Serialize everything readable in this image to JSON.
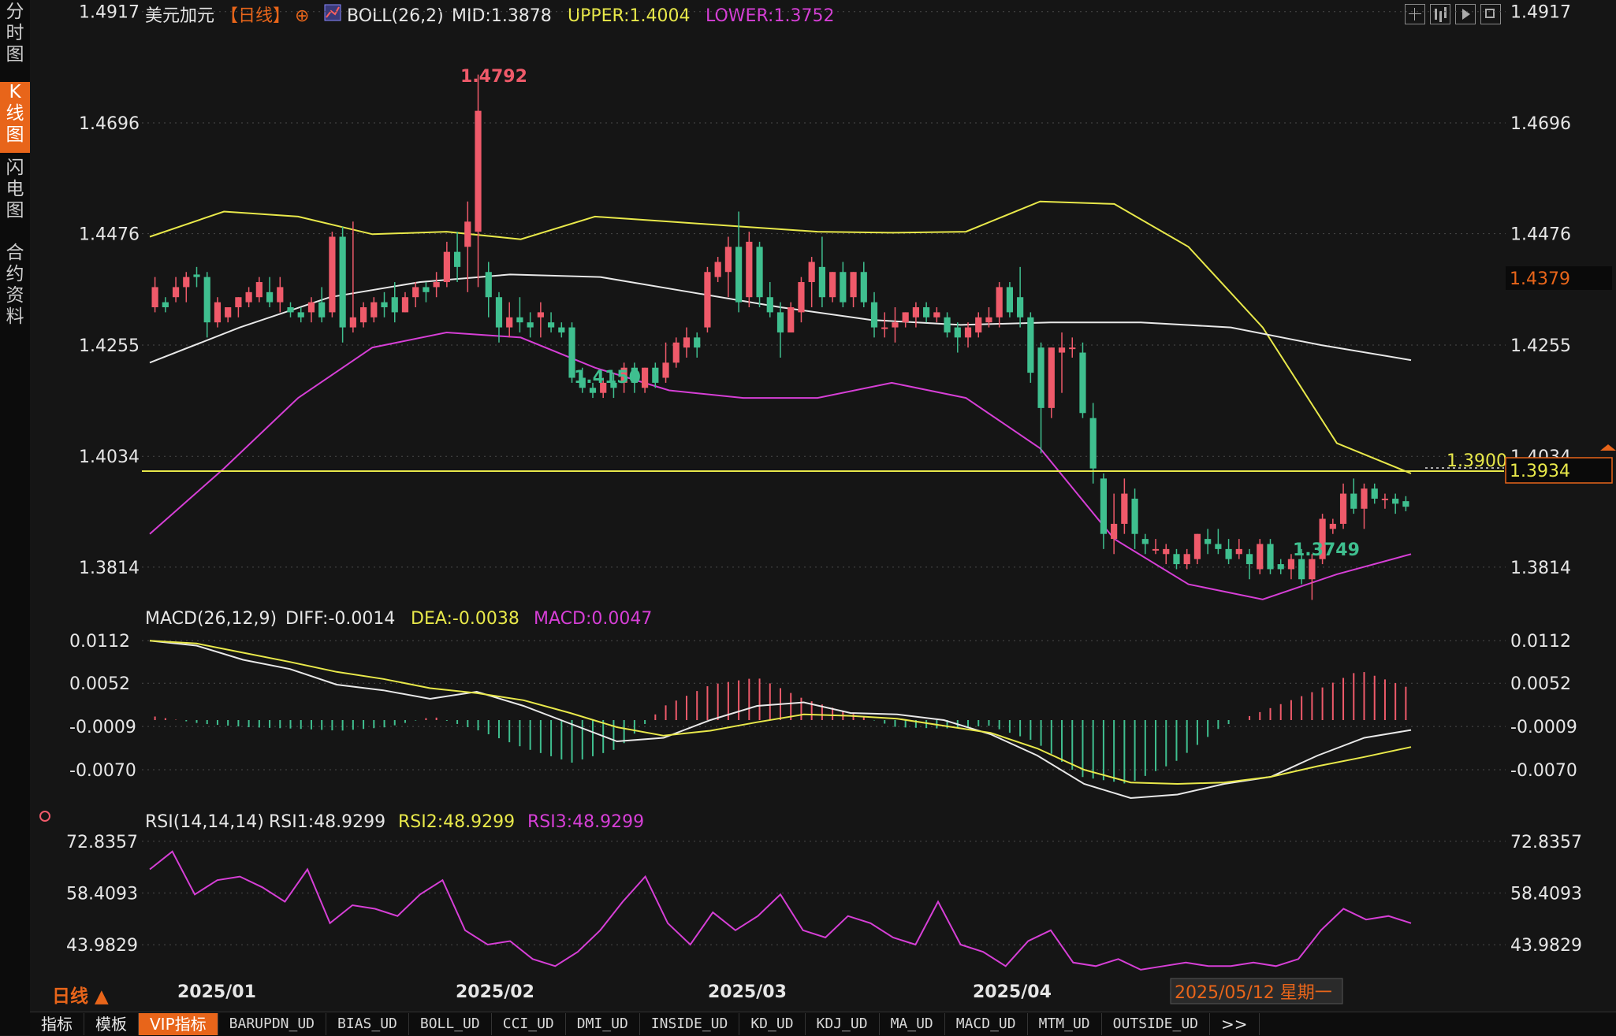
{
  "sidebar": {
    "items": [
      "分时图",
      "K线图",
      "闪电图",
      "合约资料"
    ],
    "active": 1
  },
  "header": {
    "instrument": "美元加元",
    "period": "【日线】",
    "add_symbol": "⊕",
    "boll": {
      "label": "BOLL(26,2)",
      "mid": "MID:1.3878",
      "upper": "UPPER:1.4004",
      "lower": "LOWER:1.3752"
    }
  },
  "price_axis": {
    "ticks": [
      "1.4917",
      "1.4696",
      "1.4476",
      "1.4255",
      "1.4034",
      "1.3814"
    ]
  },
  "annotations": {
    "high": "1.4792",
    "low1": "1.4150",
    "low2": "1.3749",
    "hline": "1.3900",
    "right_tag_1": "1.4379",
    "right_tag_2": "1.3934"
  },
  "macd": {
    "label": "MACD(26,12,9)",
    "diff": "DIFF:-0.0014",
    "dea": "DEA:-0.0038",
    "macd": "MACD:0.0047",
    "ticks": [
      "0.0112",
      "0.0052",
      "-0.0009",
      "-0.0070"
    ]
  },
  "rsi": {
    "label": "RSI(14,14,14)",
    "rsi1": "RSI1:48.9299",
    "rsi2": "RSI2:48.9299",
    "rsi3": "RSI3:48.9299",
    "ticks": [
      "72.8357",
      "58.4093",
      "43.9829"
    ]
  },
  "time_axis": {
    "labels": [
      "2025/01",
      "2025/02",
      "2025/03",
      "2025/04"
    ],
    "cursor_date": "2025/05/12 星期一"
  },
  "period_selector": "日线 ▲",
  "bottom_bar": [
    "指标",
    "模板",
    "VIP指标",
    "BARUPDN_UD",
    "BIAS_UD",
    "BOLL_UD",
    "CCI_UD",
    "DMI_UD",
    "INSIDE_UD",
    "KD_UD",
    "KDJ_UD",
    "MA_UD",
    "MACD_UD",
    "MTM_UD",
    "OUTSIDE_UD",
    ">>"
  ],
  "colors": {
    "up": "#ef5a6a",
    "down": "#3fbf8f",
    "boll_mid": "#e8e8e8",
    "boll_upper": "#e8e84a",
    "boll_lower": "#d63fd6",
    "accent": "#e8651a"
  },
  "chart_data": {
    "type": "candlestick",
    "price_axis_range": [
      1.372,
      1.494
    ],
    "candles": [
      {
        "o": 1.433,
        "h": 1.439,
        "l": 1.432,
        "c": 1.437
      },
      {
        "o": 1.434,
        "h": 1.435,
        "l": 1.432,
        "c": 1.433
      },
      {
        "o": 1.435,
        "h": 1.439,
        "l": 1.434,
        "c": 1.437
      },
      {
        "o": 1.437,
        "h": 1.44,
        "l": 1.434,
        "c": 1.439
      },
      {
        "o": 1.4395,
        "h": 1.441,
        "l": 1.437,
        "c": 1.439
      },
      {
        "o": 1.439,
        "h": 1.44,
        "l": 1.427,
        "c": 1.43
      },
      {
        "o": 1.43,
        "h": 1.435,
        "l": 1.429,
        "c": 1.434
      },
      {
        "o": 1.431,
        "h": 1.433,
        "l": 1.43,
        "c": 1.433
      },
      {
        "o": 1.433,
        "h": 1.435,
        "l": 1.431,
        "c": 1.435
      },
      {
        "o": 1.434,
        "h": 1.437,
        "l": 1.433,
        "c": 1.436
      },
      {
        "o": 1.435,
        "h": 1.439,
        "l": 1.434,
        "c": 1.438
      },
      {
        "o": 1.436,
        "h": 1.439,
        "l": 1.433,
        "c": 1.434
      },
      {
        "o": 1.434,
        "h": 1.439,
        "l": 1.432,
        "c": 1.437
      },
      {
        "o": 1.433,
        "h": 1.434,
        "l": 1.431,
        "c": 1.432
      },
      {
        "o": 1.432,
        "h": 1.433,
        "l": 1.43,
        "c": 1.431
      },
      {
        "o": 1.432,
        "h": 1.435,
        "l": 1.43,
        "c": 1.434
      },
      {
        "o": 1.434,
        "h": 1.437,
        "l": 1.43,
        "c": 1.431
      },
      {
        "o": 1.432,
        "h": 1.448,
        "l": 1.431,
        "c": 1.447
      },
      {
        "o": 1.447,
        "h": 1.449,
        "l": 1.426,
        "c": 1.429
      },
      {
        "o": 1.429,
        "h": 1.45,
        "l": 1.428,
        "c": 1.431
      },
      {
        "o": 1.43,
        "h": 1.434,
        "l": 1.429,
        "c": 1.433
      },
      {
        "o": 1.431,
        "h": 1.435,
        "l": 1.43,
        "c": 1.434
      },
      {
        "o": 1.434,
        "h": 1.436,
        "l": 1.431,
        "c": 1.433
      },
      {
        "o": 1.435,
        "h": 1.438,
        "l": 1.43,
        "c": 1.432
      },
      {
        "o": 1.432,
        "h": 1.436,
        "l": 1.432,
        "c": 1.435
      },
      {
        "o": 1.435,
        "h": 1.438,
        "l": 1.433,
        "c": 1.437
      },
      {
        "o": 1.437,
        "h": 1.438,
        "l": 1.434,
        "c": 1.436
      },
      {
        "o": 1.437,
        "h": 1.44,
        "l": 1.435,
        "c": 1.438
      },
      {
        "o": 1.438,
        "h": 1.446,
        "l": 1.437,
        "c": 1.444
      },
      {
        "o": 1.444,
        "h": 1.448,
        "l": 1.438,
        "c": 1.441
      },
      {
        "o": 1.445,
        "h": 1.454,
        "l": 1.436,
        "c": 1.45
      },
      {
        "o": 1.448,
        "h": 1.4792,
        "l": 1.437,
        "c": 1.472
      },
      {
        "o": 1.44,
        "h": 1.442,
        "l": 1.431,
        "c": 1.435
      },
      {
        "o": 1.435,
        "h": 1.436,
        "l": 1.426,
        "c": 1.429
      },
      {
        "o": 1.429,
        "h": 1.434,
        "l": 1.427,
        "c": 1.431
      },
      {
        "o": 1.431,
        "h": 1.435,
        "l": 1.428,
        "c": 1.43
      },
      {
        "o": 1.43,
        "h": 1.432,
        "l": 1.427,
        "c": 1.429
      },
      {
        "o": 1.431,
        "h": 1.434,
        "l": 1.427,
        "c": 1.432
      },
      {
        "o": 1.43,
        "h": 1.432,
        "l": 1.428,
        "c": 1.429
      },
      {
        "o": 1.429,
        "h": 1.43,
        "l": 1.427,
        "c": 1.428
      },
      {
        "o": 1.429,
        "h": 1.43,
        "l": 1.418,
        "c": 1.419
      },
      {
        "o": 1.419,
        "h": 1.421,
        "l": 1.416,
        "c": 1.417
      },
      {
        "o": 1.417,
        "h": 1.418,
        "l": 1.415,
        "c": 1.416
      },
      {
        "o": 1.416,
        "h": 1.419,
        "l": 1.415,
        "c": 1.418
      },
      {
        "o": 1.418,
        "h": 1.42,
        "l": 1.415,
        "c": 1.417
      },
      {
        "o": 1.418,
        "h": 1.422,
        "l": 1.416,
        "c": 1.421
      },
      {
        "o": 1.421,
        "h": 1.422,
        "l": 1.416,
        "c": 1.418
      },
      {
        "o": 1.417,
        "h": 1.421,
        "l": 1.416,
        "c": 1.421
      },
      {
        "o": 1.421,
        "h": 1.422,
        "l": 1.417,
        "c": 1.418
      },
      {
        "o": 1.419,
        "h": 1.426,
        "l": 1.418,
        "c": 1.422
      },
      {
        "o": 1.422,
        "h": 1.427,
        "l": 1.421,
        "c": 1.426
      },
      {
        "o": 1.425,
        "h": 1.429,
        "l": 1.423,
        "c": 1.427
      },
      {
        "o": 1.427,
        "h": 1.428,
        "l": 1.423,
        "c": 1.425
      },
      {
        "o": 1.429,
        "h": 1.441,
        "l": 1.428,
        "c": 1.44
      },
      {
        "o": 1.439,
        "h": 1.443,
        "l": 1.438,
        "c": 1.442
      },
      {
        "o": 1.44,
        "h": 1.447,
        "l": 1.435,
        "c": 1.445
      },
      {
        "o": 1.445,
        "h": 1.452,
        "l": 1.432,
        "c": 1.434
      },
      {
        "o": 1.435,
        "h": 1.448,
        "l": 1.433,
        "c": 1.446
      },
      {
        "o": 1.445,
        "h": 1.446,
        "l": 1.433,
        "c": 1.435
      },
      {
        "o": 1.435,
        "h": 1.438,
        "l": 1.431,
        "c": 1.432
      },
      {
        "o": 1.432,
        "h": 1.434,
        "l": 1.423,
        "c": 1.428
      },
      {
        "o": 1.428,
        "h": 1.434,
        "l": 1.428,
        "c": 1.433
      },
      {
        "o": 1.432,
        "h": 1.439,
        "l": 1.43,
        "c": 1.438
      },
      {
        "o": 1.438,
        "h": 1.443,
        "l": 1.433,
        "c": 1.442
      },
      {
        "o": 1.441,
        "h": 1.447,
        "l": 1.433,
        "c": 1.435
      },
      {
        "o": 1.435,
        "h": 1.44,
        "l": 1.434,
        "c": 1.44
      },
      {
        "o": 1.44,
        "h": 1.442,
        "l": 1.433,
        "c": 1.434
      },
      {
        "o": 1.435,
        "h": 1.44,
        "l": 1.433,
        "c": 1.44
      },
      {
        "o": 1.44,
        "h": 1.442,
        "l": 1.433,
        "c": 1.434
      },
      {
        "o": 1.434,
        "h": 1.436,
        "l": 1.427,
        "c": 1.429
      },
      {
        "o": 1.429,
        "h": 1.432,
        "l": 1.427,
        "c": 1.429
      },
      {
        "o": 1.429,
        "h": 1.433,
        "l": 1.426,
        "c": 1.43
      },
      {
        "o": 1.43,
        "h": 1.432,
        "l": 1.429,
        "c": 1.432
      },
      {
        "o": 1.431,
        "h": 1.434,
        "l": 1.429,
        "c": 1.433
      },
      {
        "o": 1.433,
        "h": 1.434,
        "l": 1.43,
        "c": 1.431
      },
      {
        "o": 1.431,
        "h": 1.433,
        "l": 1.43,
        "c": 1.432
      },
      {
        "o": 1.431,
        "h": 1.432,
        "l": 1.427,
        "c": 1.428
      },
      {
        "o": 1.429,
        "h": 1.43,
        "l": 1.424,
        "c": 1.427
      },
      {
        "o": 1.427,
        "h": 1.43,
        "l": 1.425,
        "c": 1.429
      },
      {
        "o": 1.428,
        "h": 1.432,
        "l": 1.427,
        "c": 1.431
      },
      {
        "o": 1.43,
        "h": 1.433,
        "l": 1.429,
        "c": 1.431
      },
      {
        "o": 1.431,
        "h": 1.438,
        "l": 1.429,
        "c": 1.437
      },
      {
        "o": 1.437,
        "h": 1.438,
        "l": 1.431,
        "c": 1.432
      },
      {
        "o": 1.435,
        "h": 1.441,
        "l": 1.429,
        "c": 1.431
      },
      {
        "o": 1.431,
        "h": 1.432,
        "l": 1.418,
        "c": 1.42
      },
      {
        "o": 1.425,
        "h": 1.426,
        "l": 1.404,
        "c": 1.413
      },
      {
        "o": 1.413,
        "h": 1.425,
        "l": 1.411,
        "c": 1.425
      },
      {
        "o": 1.424,
        "h": 1.428,
        "l": 1.416,
        "c": 1.425
      },
      {
        "o": 1.425,
        "h": 1.427,
        "l": 1.423,
        "c": 1.425
      },
      {
        "o": 1.424,
        "h": 1.426,
        "l": 1.411,
        "c": 1.412
      },
      {
        "o": 1.411,
        "h": 1.414,
        "l": 1.398,
        "c": 1.401
      },
      {
        "o": 1.399,
        "h": 1.4,
        "l": 1.385,
        "c": 1.388
      },
      {
        "o": 1.387,
        "h": 1.396,
        "l": 1.384,
        "c": 1.39
      },
      {
        "o": 1.39,
        "h": 1.399,
        "l": 1.388,
        "c": 1.396
      },
      {
        "o": 1.395,
        "h": 1.397,
        "l": 1.385,
        "c": 1.388
      },
      {
        "o": 1.387,
        "h": 1.388,
        "l": 1.384,
        "c": 1.386
      },
      {
        "o": 1.385,
        "h": 1.387,
        "l": 1.384,
        "c": 1.385
      },
      {
        "o": 1.384,
        "h": 1.386,
        "l": 1.382,
        "c": 1.385
      },
      {
        "o": 1.384,
        "h": 1.385,
        "l": 1.381,
        "c": 1.382
      },
      {
        "o": 1.382,
        "h": 1.385,
        "l": 1.381,
        "c": 1.384
      },
      {
        "o": 1.383,
        "h": 1.388,
        "l": 1.382,
        "c": 1.388
      },
      {
        "o": 1.387,
        "h": 1.389,
        "l": 1.384,
        "c": 1.386
      },
      {
        "o": 1.386,
        "h": 1.389,
        "l": 1.384,
        "c": 1.385
      },
      {
        "o": 1.385,
        "h": 1.387,
        "l": 1.382,
        "c": 1.383
      },
      {
        "o": 1.384,
        "h": 1.387,
        "l": 1.383,
        "c": 1.385
      },
      {
        "o": 1.384,
        "h": 1.385,
        "l": 1.379,
        "c": 1.382
      },
      {
        "o": 1.381,
        "h": 1.387,
        "l": 1.38,
        "c": 1.386
      },
      {
        "o": 1.386,
        "h": 1.387,
        "l": 1.38,
        "c": 1.381
      },
      {
        "o": 1.382,
        "h": 1.383,
        "l": 1.38,
        "c": 1.381
      },
      {
        "o": 1.381,
        "h": 1.384,
        "l": 1.379,
        "c": 1.383
      },
      {
        "o": 1.383,
        "h": 1.385,
        "l": 1.378,
        "c": 1.379
      },
      {
        "o": 1.379,
        "h": 1.384,
        "l": 1.3749,
        "c": 1.383
      },
      {
        "o": 1.383,
        "h": 1.392,
        "l": 1.382,
        "c": 1.391
      },
      {
        "o": 1.389,
        "h": 1.391,
        "l": 1.388,
        "c": 1.39
      },
      {
        "o": 1.39,
        "h": 1.398,
        "l": 1.389,
        "c": 1.396
      },
      {
        "o": 1.396,
        "h": 1.399,
        "l": 1.392,
        "c": 1.393
      },
      {
        "o": 1.393,
        "h": 1.398,
        "l": 1.389,
        "c": 1.397
      },
      {
        "o": 1.397,
        "h": 1.398,
        "l": 1.394,
        "c": 1.395
      },
      {
        "o": 1.395,
        "h": 1.396,
        "l": 1.393,
        "c": 1.395
      },
      {
        "o": 1.395,
        "h": 1.396,
        "l": 1.392,
        "c": 1.394
      },
      {
        "o": 1.3945,
        "h": 1.3955,
        "l": 1.3925,
        "c": 1.3934
      }
    ],
    "boll_mid": [
      1.422,
      1.429,
      1.435,
      1.438,
      1.4395,
      1.439,
      1.436,
      1.433,
      1.4305,
      1.4295,
      1.43,
      1.43,
      1.429,
      1.4255,
      1.4225
    ],
    "boll_upper": [
      1.447,
      1.452,
      1.451,
      1.4475,
      1.448,
      1.4465,
      1.451,
      1.45,
      1.449,
      1.448,
      1.4478,
      1.448,
      1.454,
      1.4535,
      1.445,
      1.429,
      1.406,
      1.4
    ],
    "boll_lower": [
      1.388,
      1.401,
      1.415,
      1.425,
      1.428,
      1.427,
      1.421,
      1.4165,
      1.415,
      1.415,
      1.418,
      1.415,
      1.405,
      1.387,
      1.378,
      1.375,
      1.38,
      1.384
    ],
    "macd_axis_range": [
      -0.014,
      0.012
    ],
    "macd_diff": [
      0.0112,
      0.0105,
      0.0085,
      0.0072,
      0.005,
      0.0042,
      0.003,
      0.004,
      0.002,
      -0.0005,
      -0.003,
      -0.0025,
      0.0,
      0.002,
      0.0025,
      0.001,
      0.0008,
      0.0,
      -0.002,
      -0.005,
      -0.009,
      -0.011,
      -0.0105,
      -0.009,
      -0.008,
      -0.005,
      -0.0025,
      -0.0014
    ],
    "macd_dea": [
      0.0112,
      0.0108,
      0.0095,
      0.0082,
      0.0068,
      0.0058,
      0.0045,
      0.0038,
      0.0028,
      0.001,
      -0.001,
      -0.0022,
      -0.0015,
      -0.0003,
      0.0008,
      0.0006,
      0.0002,
      -0.0008,
      -0.0018,
      -0.004,
      -0.007,
      -0.0088,
      -0.009,
      -0.0088,
      -0.008,
      -0.0065,
      -0.0052,
      -0.0038
    ],
    "macd_hist": [
      0.0005,
      -0.0005,
      -0.001,
      -0.0012,
      -0.0015,
      -0.001,
      0.0005,
      -0.0015,
      -0.004,
      -0.006,
      -0.004,
      0.002,
      0.005,
      0.006,
      0.003,
      0.001,
      -0.001,
      -0.0012,
      -0.0008,
      -0.003,
      -0.008,
      -0.009,
      -0.006,
      -0.001,
      0.0015,
      0.004,
      0.007,
      0.0047
    ],
    "rsi_axis_range": [
      35,
      75
    ],
    "rsi": [
      65,
      70,
      58,
      62,
      63,
      60,
      56,
      65,
      50,
      55,
      54,
      52,
      58,
      62,
      48,
      44,
      45,
      40,
      38,
      42,
      48,
      56,
      63,
      50,
      44,
      53,
      48,
      52,
      58,
      48,
      46,
      52,
      50,
      46,
      44,
      56,
      44,
      42,
      38,
      45,
      48,
      39,
      38,
      40,
      37,
      38,
      39,
      38,
      38,
      39,
      38,
      40,
      48,
      54,
      51,
      52,
      50
    ]
  }
}
